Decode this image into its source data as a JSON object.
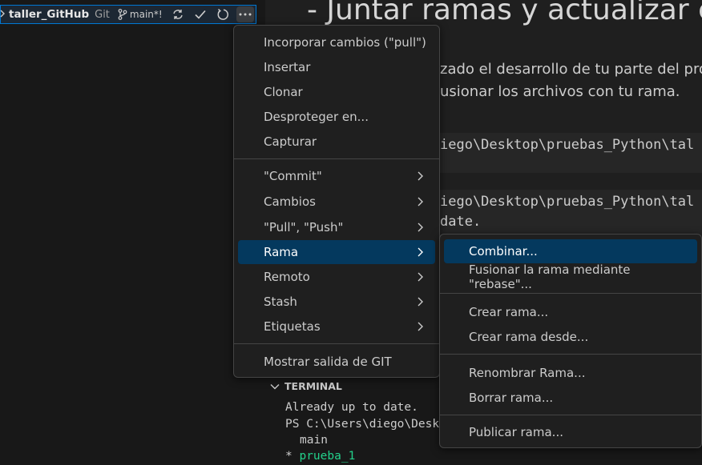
{
  "scm_header": {
    "repo_name": "taller_GitHub",
    "provider": "Git",
    "branch": "main*!",
    "icons": [
      "chevron-right-icon",
      "git-branch-icon",
      "sync-icon",
      "check-icon",
      "refresh-icon",
      "more-actions-icon"
    ]
  },
  "editor": {
    "heading": "- Juntar ramas y actualizar c",
    "para_lines": [
      "zado el desarrollo de tu parte del pro",
      "usionar los archivos con tu rama."
    ],
    "code_lines": [
      "iego\\Desktop\\pruebas_Python\\tal",
      "iego\\Desktop\\pruebas_Python\\tal",
      "date."
    ]
  },
  "terminal": {
    "title": "TERMINAL",
    "lines": [
      "Already up to date.",
      "PS C:\\Users\\diego\\Desk",
      "main"
    ],
    "current_branch_marker": "*",
    "current_branch": "prueba_1",
    "current_branch_color": "#23d18b"
  },
  "main_menu": {
    "items": [
      {
        "label": "Incorporar cambios (\"pull\")"
      },
      {
        "label": "Insertar"
      },
      {
        "label": "Clonar"
      },
      {
        "label": "Desproteger en..."
      },
      {
        "label": "Capturar"
      },
      {
        "label": "\"Commit\"",
        "submenu": true
      },
      {
        "label": "Cambios",
        "submenu": true
      },
      {
        "label": "\"Pull\", \"Push\"",
        "submenu": true
      },
      {
        "label": "Rama",
        "submenu": true,
        "active": true
      },
      {
        "label": "Remoto",
        "submenu": true
      },
      {
        "label": "Stash",
        "submenu": true
      },
      {
        "label": "Etiquetas",
        "submenu": true
      },
      {
        "label": "Mostrar salida de GIT"
      }
    ]
  },
  "branch_menu": {
    "items": [
      {
        "label": "Combinar...",
        "active": true
      },
      {
        "label": "Fusionar la rama mediante \"rebase\"..."
      },
      {
        "label": "Crear rama..."
      },
      {
        "label": "Crear rama desde..."
      },
      {
        "label": "Renombrar Rama..."
      },
      {
        "label": "Borrar rama..."
      },
      {
        "label": "Publicar rama..."
      }
    ]
  },
  "colors": {
    "accent": "#0078d4",
    "menu_highlight": "#04395e",
    "menu_bg": "#1f1f1f"
  }
}
